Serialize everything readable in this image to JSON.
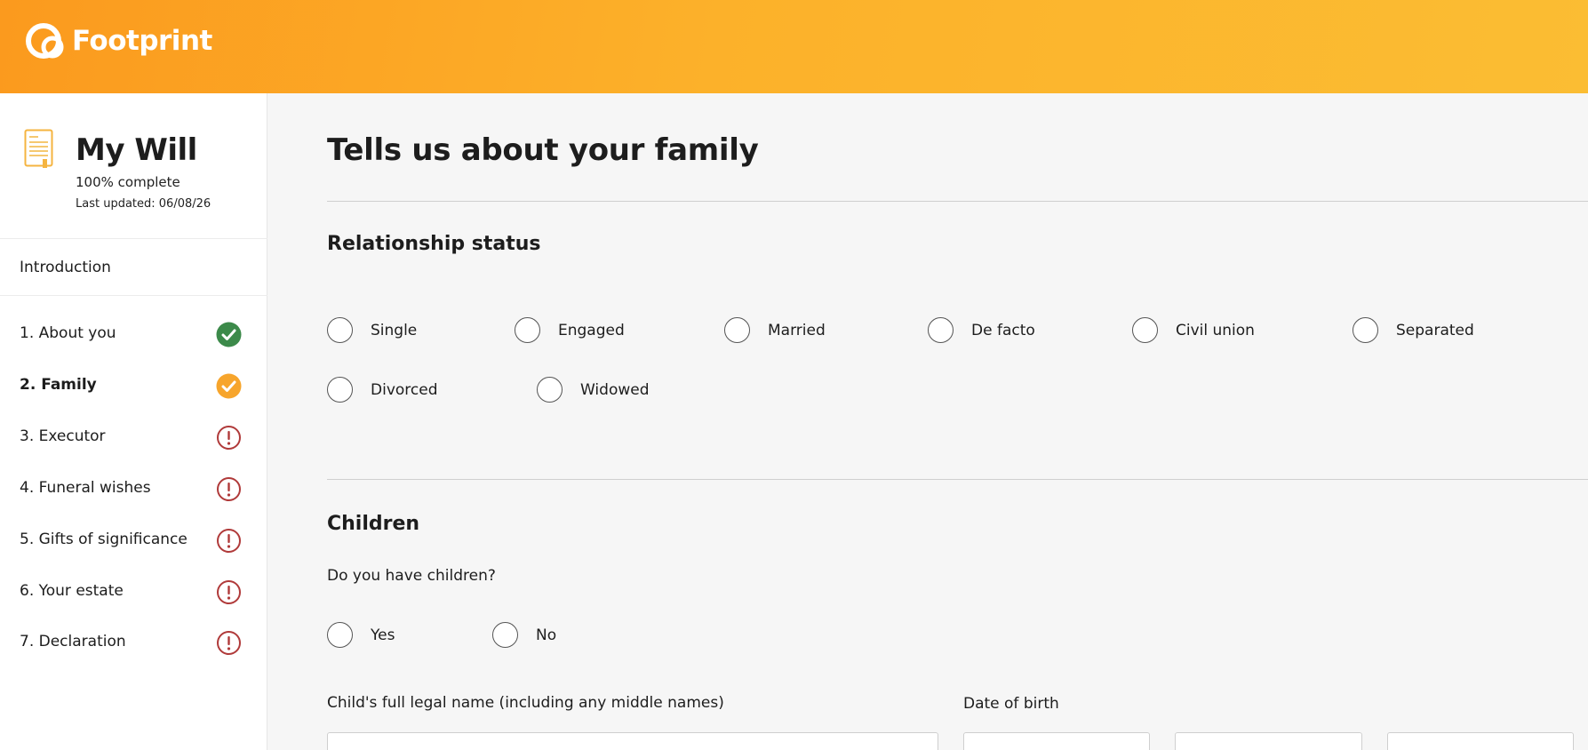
{
  "brand": {
    "name": "Footprint"
  },
  "colors": {
    "accent": "#fca52a",
    "complete": "#3c8a4a",
    "current": "#f7a52c",
    "warning": "#b03a3a"
  },
  "will": {
    "title": "My Will",
    "progress": "100% complete",
    "last_updated": "Last updated: 06/08/26"
  },
  "nav": {
    "intro": "Introduction",
    "items": [
      {
        "label": "1. About you",
        "status": "complete"
      },
      {
        "label": "2. Family",
        "status": "current"
      },
      {
        "label": "3. Executor",
        "status": "incomplete"
      },
      {
        "label": "4. Funeral wishes",
        "status": "incomplete"
      },
      {
        "label": "5. Gifts of significance",
        "status": "incomplete"
      },
      {
        "label": "6. Your estate",
        "status": "incomplete"
      },
      {
        "label": "7. Declaration",
        "status": "incomplete"
      }
    ]
  },
  "main": {
    "title": "Tells us about your family",
    "relationship": {
      "heading": "Relationship status",
      "options": [
        "Single",
        "Engaged",
        "Married",
        "De facto",
        "Civil union",
        "Separated",
        "Divorced",
        "Widowed"
      ]
    },
    "children": {
      "heading": "Children",
      "question": "Do you have children?",
      "options": [
        "Yes",
        "No"
      ],
      "name_label": "Child's full legal name (including any middle names)",
      "dob_label": "Date of birth"
    }
  }
}
